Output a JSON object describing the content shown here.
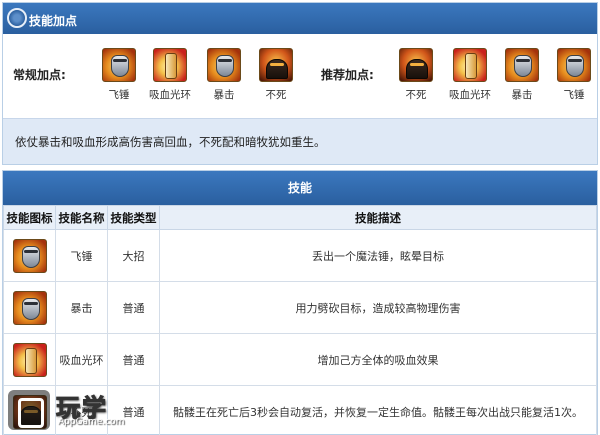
{
  "panel": {
    "title": "技能加点",
    "regular_label": "常规加点:",
    "recommended_label": "推荐加点:",
    "regular": [
      {
        "label": "飞锤",
        "icon": "hammer-glove-icon"
      },
      {
        "label": "吸血光环",
        "icon": "vampiric-aura-icon"
      },
      {
        "label": "暴击",
        "icon": "critical-strike-icon"
      },
      {
        "label": "不死",
        "icon": "reincarnation-icon"
      }
    ],
    "recommended": [
      {
        "label": "不死",
        "icon": "reincarnation-icon"
      },
      {
        "label": "吸血光环",
        "icon": "vampiric-aura-icon"
      },
      {
        "label": "暴击",
        "icon": "critical-strike-icon"
      },
      {
        "label": "飞锤",
        "icon": "hammer-glove-icon"
      }
    ],
    "note": "依仗暴击和吸血形成高伤害高回血，不死配和暗牧犹如重生。"
  },
  "skills": {
    "title": "技能",
    "headers": [
      "技能图标",
      "技能名称",
      "技能类型",
      "技能描述"
    ],
    "rows": [
      {
        "name": "飞锤",
        "type": "大招",
        "desc": "丢出一个魔法锤，眩晕目标"
      },
      {
        "name": "暴击",
        "type": "普通",
        "desc": "用力劈砍目标，造成较高物理伤害"
      },
      {
        "name": "吸血光环",
        "type": "普通",
        "desc": "增加己方全体的吸血效果"
      },
      {
        "name": "不死",
        "type": "普通",
        "desc": "骷髅王在死亡后3秒会自动复活，并恢复一定生命值。骷髅王每次出战只能复活1次。"
      }
    ]
  },
  "watermark": {
    "text": "玩学",
    "sub": "AppGame.com"
  },
  "colors": {
    "header": "#2f67a9",
    "note_bg": "#dfe9f6",
    "table_head": "#e8eff8"
  }
}
